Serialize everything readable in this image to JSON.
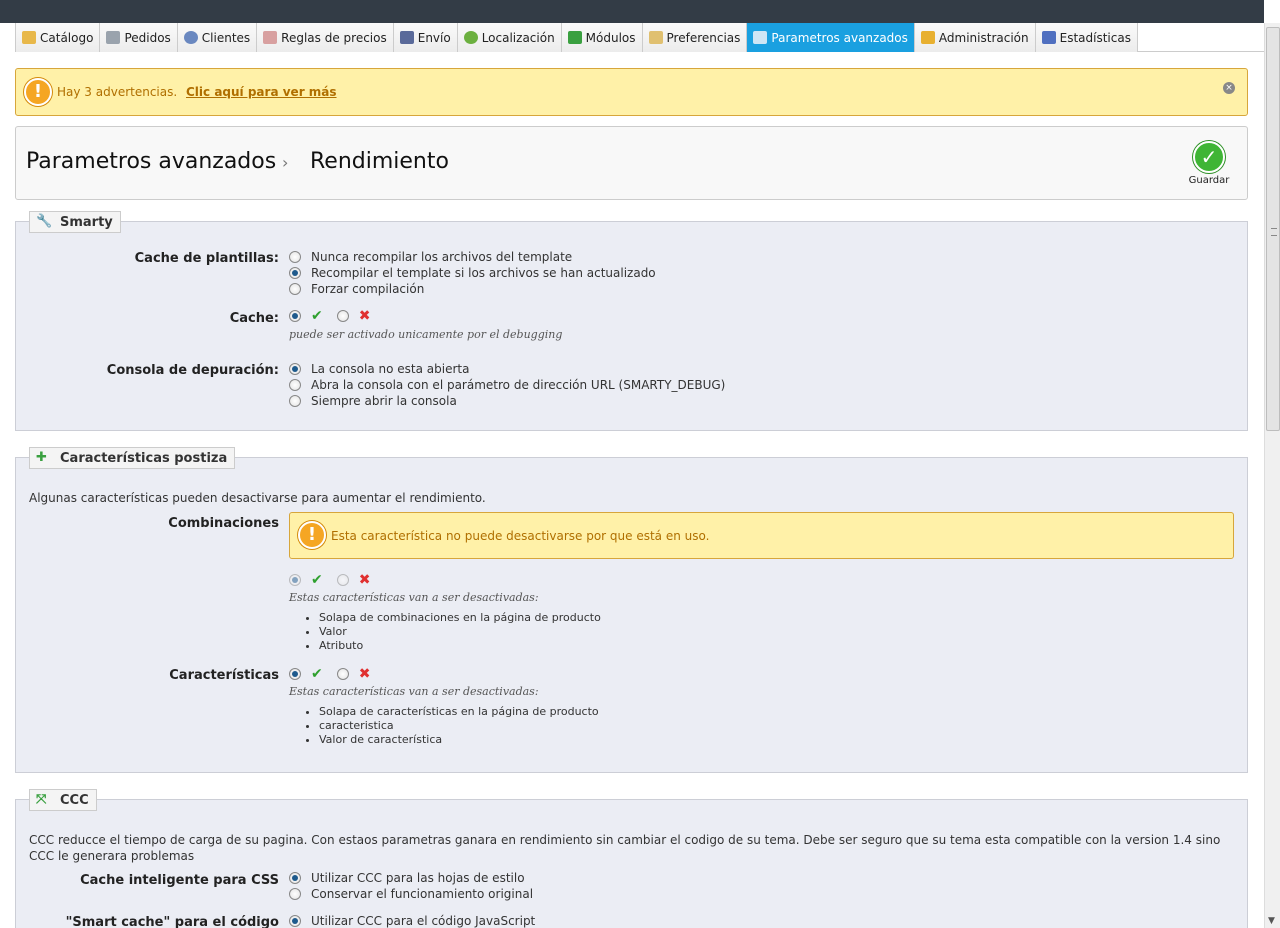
{
  "nav": [
    {
      "label": "Catálogo",
      "icon": "folder-icon",
      "color": "#e8b84a"
    },
    {
      "label": "Pedidos",
      "icon": "cart-icon",
      "color": "#9aa3ad"
    },
    {
      "label": "Clientes",
      "icon": "user-icon",
      "color": "#6a88c0"
    },
    {
      "label": "Reglas de precios",
      "icon": "tag-icon",
      "color": "#d8a0a0"
    },
    {
      "label": "Envío",
      "icon": "truck-icon",
      "color": "#5a6a9a"
    },
    {
      "label": "Localización",
      "icon": "globe-icon",
      "color": "#6cb040"
    },
    {
      "label": "Módulos",
      "icon": "puzzle-icon",
      "color": "#3aa040"
    },
    {
      "label": "Preferencias",
      "icon": "preferences-icon",
      "color": "#e0c070"
    },
    {
      "label": "Parametros avanzados",
      "icon": "wrench-icon",
      "color": "#cfe6f5",
      "active": true
    },
    {
      "label": "Administración",
      "icon": "key-icon",
      "color": "#e8b030"
    },
    {
      "label": "Estadísticas",
      "icon": "stats-icon",
      "color": "#5070c0"
    }
  ],
  "alert": {
    "text": "Hay 3 advertencias.",
    "link": "Clic aquí para ver más"
  },
  "header": {
    "section": "Parametros avanzados",
    "separator": "›",
    "page": "Rendimiento",
    "save": "Guardar"
  },
  "smarty": {
    "legend": "Smarty",
    "template_cache": {
      "label": "Cache de plantillas:",
      "options": [
        "Nunca recompilar los archivos del template",
        "Recompilar el template si los archivos se han actualizado",
        "Forzar compilación"
      ],
      "selected": 1
    },
    "cache": {
      "label": "Cache:",
      "yes": "✔",
      "no": "✖",
      "hint": "puede ser activado unicamente por el debugging"
    },
    "console": {
      "label": "Consola de depuración:",
      "options": [
        "La consola no esta abierta",
        "Abra la consola con el parámetro de dirección URL (SMARTY_DEBUG)",
        "Siempre abrir la consola"
      ],
      "selected": 0
    }
  },
  "features": {
    "legend": "Características postiza",
    "desc": "Algunas características pueden desactivarse para aumentar el rendimiento.",
    "combinations": {
      "label": "Combinaciones",
      "warning": "Esta característica no puede desactivarse por que está en uso.",
      "yes": "✔",
      "no": "✖",
      "hint": "Estas características van a ser desactivadas:",
      "items": [
        "Solapa de combinaciones en la página de producto",
        "Valor",
        "Atributo"
      ]
    },
    "characteristics": {
      "label": "Características",
      "yes": "✔",
      "no": "✖",
      "hint": "Estas características van a ser desactivadas:",
      "items": [
        "Solapa de características en la página de producto",
        "caracteristica",
        "Valor de característica"
      ]
    }
  },
  "ccc": {
    "legend": "CCC",
    "desc": "CCC reducce el tiempo de carga de su pagina. Con estaos parametras ganara en rendimiento sin cambiar el codigo de su tema. Debe ser seguro que su tema esta compatible con la version 1.4 sino CCC le generara problemas",
    "css": {
      "label": "Cache inteligente para CSS",
      "options": [
        "Utilizar CCC para las hojas de estilo",
        "Conservar el funcionamiento original"
      ],
      "selected": 0
    },
    "js": {
      "label": "\"Smart cache\" para el código",
      "options": [
        "Utilizar CCC para el código JavaScript"
      ],
      "selected": 0
    }
  }
}
